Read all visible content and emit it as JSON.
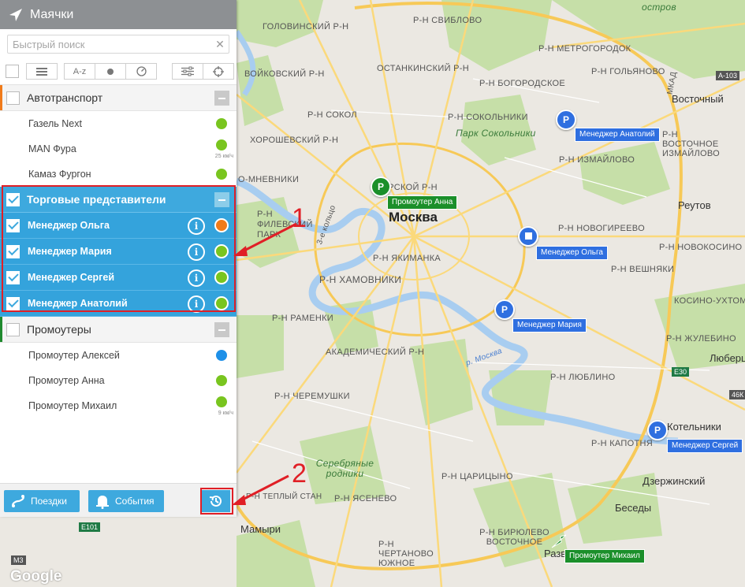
{
  "panel": {
    "title": "Маячки",
    "search_placeholder": "Быстрый поиск",
    "toolbar": {
      "sort_label": "A-z"
    },
    "groups": [
      {
        "label": "Автотранспорт",
        "stripe": "#f07b1a",
        "items": [
          {
            "label": "Газель Next",
            "status": "#79c51f",
            "speed": ""
          },
          {
            "label": "MAN Фура",
            "status": "#79c51f",
            "speed": "25 км/ч"
          },
          {
            "label": "Камаз Фургон",
            "status": "#79c51f",
            "speed": ""
          }
        ]
      },
      {
        "label": "Торговые представители",
        "stripe": "#3ea9de",
        "items": [
          {
            "label": "Менеджер Ольга",
            "status": "#f07b1a"
          },
          {
            "label": "Менеджер Мария",
            "status": "#79c51f"
          },
          {
            "label": "Менеджер Сергей",
            "status": "#79c51f"
          },
          {
            "label": "Менеджер Анатолий",
            "status": "#79c51f"
          }
        ]
      },
      {
        "label": "Промоутеры",
        "stripe": "#1f8a2e",
        "items": [
          {
            "label": "Промоутер Алексей",
            "status": "#1e90e8",
            "speed": ""
          },
          {
            "label": "Промоутер Анна",
            "status": "#79c51f",
            "speed": ""
          },
          {
            "label": "Промоутер Михаил",
            "status": "#79c51f",
            "speed": "9 км/ч"
          }
        ]
      }
    ],
    "bottom": {
      "trips_label": "Поездки",
      "events_label": "События"
    }
  },
  "annotations": {
    "one": "1",
    "two": "2"
  },
  "map": {
    "city": "Москва",
    "labels": {
      "l1": "ГОЛОВИНСКИЙ Р-Н",
      "l2": "Р-Н СВИБЛОВО",
      "l3": "Р-Н МЕТРОГОРОДОК",
      "l4": "ОСТАНКИНСКИЙ Р-Н",
      "l5": "Р-Н ГОЛЬЯНОВО",
      "l6": "ВОЙКОВСКИЙ Р-Н",
      "l7": "Р-Н БОГОРОДСКОЕ",
      "l8": "Восточный",
      "l9": "Р-Н СОКОЛЬНИКИ",
      "l10": "Р-Н СОКОЛ",
      "l11": "Парк Сокольники",
      "l12": "ХОРОШЕВСКИЙ Р-Н",
      "l13": "Р-Н ИЗМАЙЛОВО",
      "l14": "Р-Н ВОСТОЧНОЕ ИЗМАЙЛОВО",
      "l15": "О-МНЕВНИКИ",
      "l16": "ТВЕРСКОЙ Р-Н",
      "l17": "Реутов",
      "l18": "Р-Н ФИЛЕВСКИЙ ПАРК",
      "l19": "Р-Н НОВОГИРЕЕВО",
      "l20": "Р-Н ЯКИМАНКА",
      "l21": "Р-Н НОВОКОСИНО",
      "l22": "Р-Н ХАМОВНИКИ",
      "l23": "Р-Н ВЕШНЯКИ",
      "l24": "КОСИНО-УХТОМСКИЙ",
      "l25": "Р-Н РАМЕНКИ",
      "l26": "АКАДЕМИЧЕСКИЙ Р-Н",
      "l27": "Р-Н ЖУЛЕБИНО",
      "l28": "Р-Н ЛЮБЛИНО",
      "l29": "Люберцы",
      "l30": "Р-Н ЧЕРЕМУШКИ",
      "l31": "Котельники",
      "l32": "Р-Н КАПОТНЯ",
      "l33": "Серебряные родники",
      "l34": "Р-Н ЦАРИЦЫНО",
      "l35": "Дзержинский",
      "l36": "Р-Н ЯСЕНЕВО",
      "l37": "Беседы",
      "l38": "Мамыри",
      "l39": "Р-Н ЧЕРТАНОВО ЮЖНОЕ",
      "l40": "Р-Н БИРЮЛЕВО ВОСТОЧНОЕ",
      "l41": "Развилка",
      "l42": "остров",
      "l43": "Р-Н ТЕПЛЫЙ СТАН",
      "l44": "МКАД",
      "l45": "3-е кольцо",
      "l46": "р. Москва"
    },
    "shields": {
      "s1": "А-103",
      "s2": "E30",
      "s3": "46К",
      "s4": "E101",
      "s5": "М3"
    },
    "tags": {
      "anatoliy": "Менеджер Анатолий",
      "anna": "Промоутер Анна",
      "olga": "Менеджер Ольга",
      "maria": "Менеджер Мария",
      "sergey": "Менеджер Сергей",
      "mikhail": "Промоутер Михаил"
    },
    "marker_letter": "P",
    "google": "Google"
  }
}
